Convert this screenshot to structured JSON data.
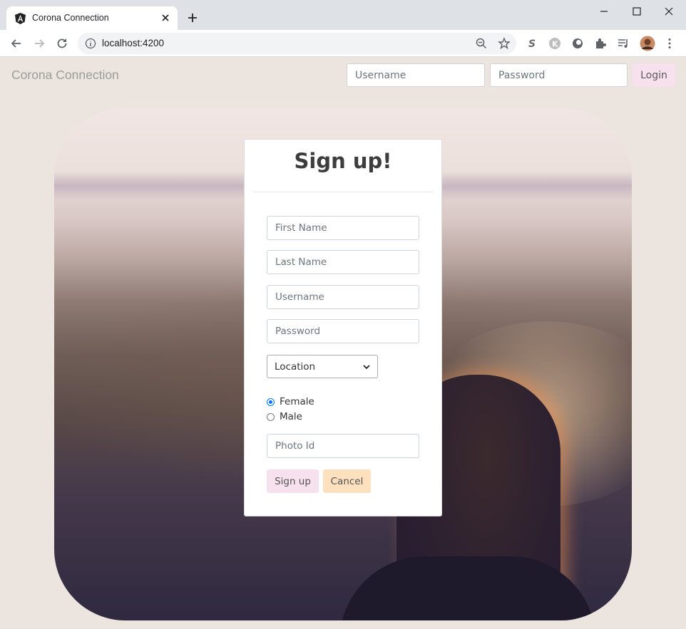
{
  "browser": {
    "tab_title": "Corona Connection",
    "url_host": "localhost:4200"
  },
  "navbar": {
    "brand": "Corona Connection",
    "username_placeholder": "Username",
    "password_placeholder": "Password",
    "login_label": "Login"
  },
  "signup": {
    "title": "Sign up!",
    "first_name_placeholder": "First Name",
    "last_name_placeholder": "Last Name",
    "username_placeholder": "Username",
    "password_placeholder": "Password",
    "location_selected": "Location",
    "gender_options": [
      {
        "label": "Female",
        "checked": true
      },
      {
        "label": "Male",
        "checked": false
      }
    ],
    "photo_placeholder": "Photo Id",
    "signup_label": "Sign up",
    "cancel_label": "Cancel"
  },
  "colors": {
    "page_bg": "#ece4de",
    "login_button": "#f8e1ee",
    "signup_button": "#f8e1ee",
    "cancel_button": "#fde0bd",
    "radio_accent": "#0075ff"
  }
}
